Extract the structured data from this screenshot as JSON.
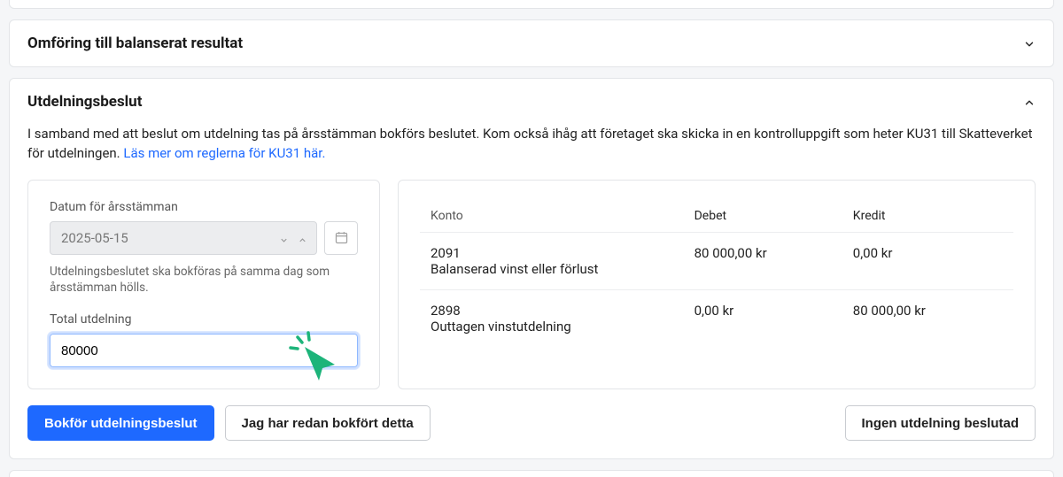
{
  "section1": {
    "title": "Omföring till balanserat resultat"
  },
  "section2": {
    "title": "Utdelningsbeslut",
    "description": "I samband med att beslut om utdelning tas på årsstämman bokförs beslutet. Kom också ihåg att företaget ska skicka in en kontrolluppgift som heter KU31 till Skatteverket för utdelningen. ",
    "link_text": "Läs mer om reglerna för KU31 här.",
    "date_label": "Datum för årsstämman",
    "date_value": "2025-05-15",
    "date_hint": "Utdelningsbeslutet ska bokföras på samma dag som årsstämman hölls.",
    "total_label": "Total utdelning",
    "total_value": "80000",
    "table": {
      "headers": {
        "konto": "Konto",
        "debet": "Debet",
        "kredit": "Kredit"
      },
      "rows": [
        {
          "code": "2091",
          "name": "Balanserad vinst eller förlust",
          "debet": "80 000,00 kr",
          "kredit": "0,00 kr"
        },
        {
          "code": "2898",
          "name": "Outtagen vinstutdelning",
          "debet": "0,00 kr",
          "kredit": "80 000,00 kr"
        }
      ]
    },
    "buttons": {
      "primary": "Bokför utdelningsbeslut",
      "secondary": "Jag har redan bokfört detta",
      "tertiary": "Ingen utdelning beslutad"
    }
  }
}
